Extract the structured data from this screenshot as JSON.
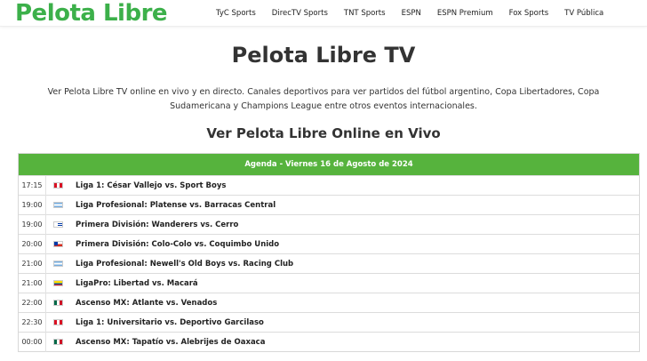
{
  "site": {
    "logo": "Pelota Libre",
    "nav": [
      "TyC Sports",
      "DirecTV Sports",
      "TNT Sports",
      "ESPN",
      "ESPN Premium",
      "Fox Sports",
      "TV Pública"
    ]
  },
  "main": {
    "title": "Pelota Libre TV",
    "description": "Ver Pelota Libre TV online en vivo y en directo. Canales deportivos para ver partidos del fútbol argentino, Copa Libertadores, Copa Sudamericana y Champions League entre otros eventos internacionales.",
    "subtitle": "Ver Pelota Libre Online en Vivo"
  },
  "agenda": {
    "header": "Agenda - Viernes 16 de Agosto de 2024",
    "events": [
      {
        "time": "17:15",
        "country": "peru",
        "match": "Liga 1: César Vallejo vs. Sport Boys"
      },
      {
        "time": "19:00",
        "country": "argentina",
        "match": "Liga Profesional: Platense vs. Barracas Central"
      },
      {
        "time": "19:00",
        "country": "uruguay",
        "match": "Primera División: Wanderers vs. Cerro"
      },
      {
        "time": "20:00",
        "country": "chile",
        "match": "Primera División: Colo-Colo vs. Coquimbo Unido"
      },
      {
        "time": "21:00",
        "country": "argentina",
        "match": "Liga Profesional: Newell's Old Boys vs. Racing Club"
      },
      {
        "time": "21:00",
        "country": "ecuador",
        "match": "LigaPro: Libertad vs. Macará"
      },
      {
        "time": "22:00",
        "country": "mexico",
        "match": "Ascenso MX: Atlante vs. Venados"
      },
      {
        "time": "22:30",
        "country": "peru",
        "match": "Liga 1: Universitario vs. Deportivo Garcilaso"
      },
      {
        "time": "00:00",
        "country": "mexico",
        "match": "Ascenso MX: Tapatío vs. Alebrijes de Oaxaca"
      }
    ]
  },
  "colors": {
    "brand_green": "#3cb04a",
    "agenda_header": "#56b33d"
  }
}
